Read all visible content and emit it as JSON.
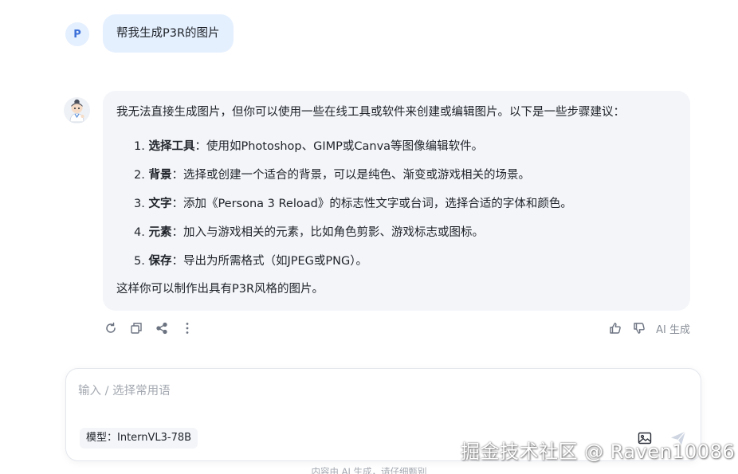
{
  "user": {
    "avatar_initial": "P",
    "message": "帮我生成P3R的图片"
  },
  "assistant": {
    "avatar_icon": "robot-cartoon-avatar",
    "intro": "我无法直接生成图片，但你可以使用一些在线工具或软件来创建或编辑图片。以下是一些步骤建议：",
    "steps": [
      {
        "num": "1.",
        "title": "选择工具",
        "text": "：使用如Photoshop、GIMP或Canva等图像编辑软件。"
      },
      {
        "num": "2.",
        "title": "背景",
        "text": "：选择或创建一个适合的背景，可以是纯色、渐变或游戏相关的场景。"
      },
      {
        "num": "3.",
        "title": "文字",
        "text": "：添加《Persona 3 Reload》的标志性文字或台词，选择合适的字体和颜色。"
      },
      {
        "num": "4.",
        "title": "元素",
        "text": "：加入与游戏相关的元素，比如角色剪影、游戏标志或图标。"
      },
      {
        "num": "5.",
        "title": "保存",
        "text": "：导出为所需格式（如JPEG或PNG）。"
      }
    ],
    "outro": "这样你可以制作出具有P3R风格的图片。"
  },
  "actions": {
    "icons": [
      "refresh-icon",
      "copy-icon",
      "share-icon",
      "more-icon"
    ],
    "feedback_icons": [
      "thumbs-up-icon",
      "thumbs-down-icon"
    ],
    "ai_generated_label": "AI 生成"
  },
  "composer": {
    "placeholder": "输入 / 选择常用语",
    "value": "",
    "model_label": "模型：InternVL3-78B",
    "image_icon": "image-upload-icon",
    "send_icon": "send-icon"
  },
  "footer": {
    "disclaimer": "内容由 AI 生成，请仔细甄别",
    "watermark": "掘金技术社区 @ Raven10086"
  },
  "colors": {
    "user_bubble": "#e5f0ff",
    "ai_bubble": "#f3f5f9",
    "avatar_bg": "#e4efff",
    "avatar_text": "#3b6fd8"
  }
}
